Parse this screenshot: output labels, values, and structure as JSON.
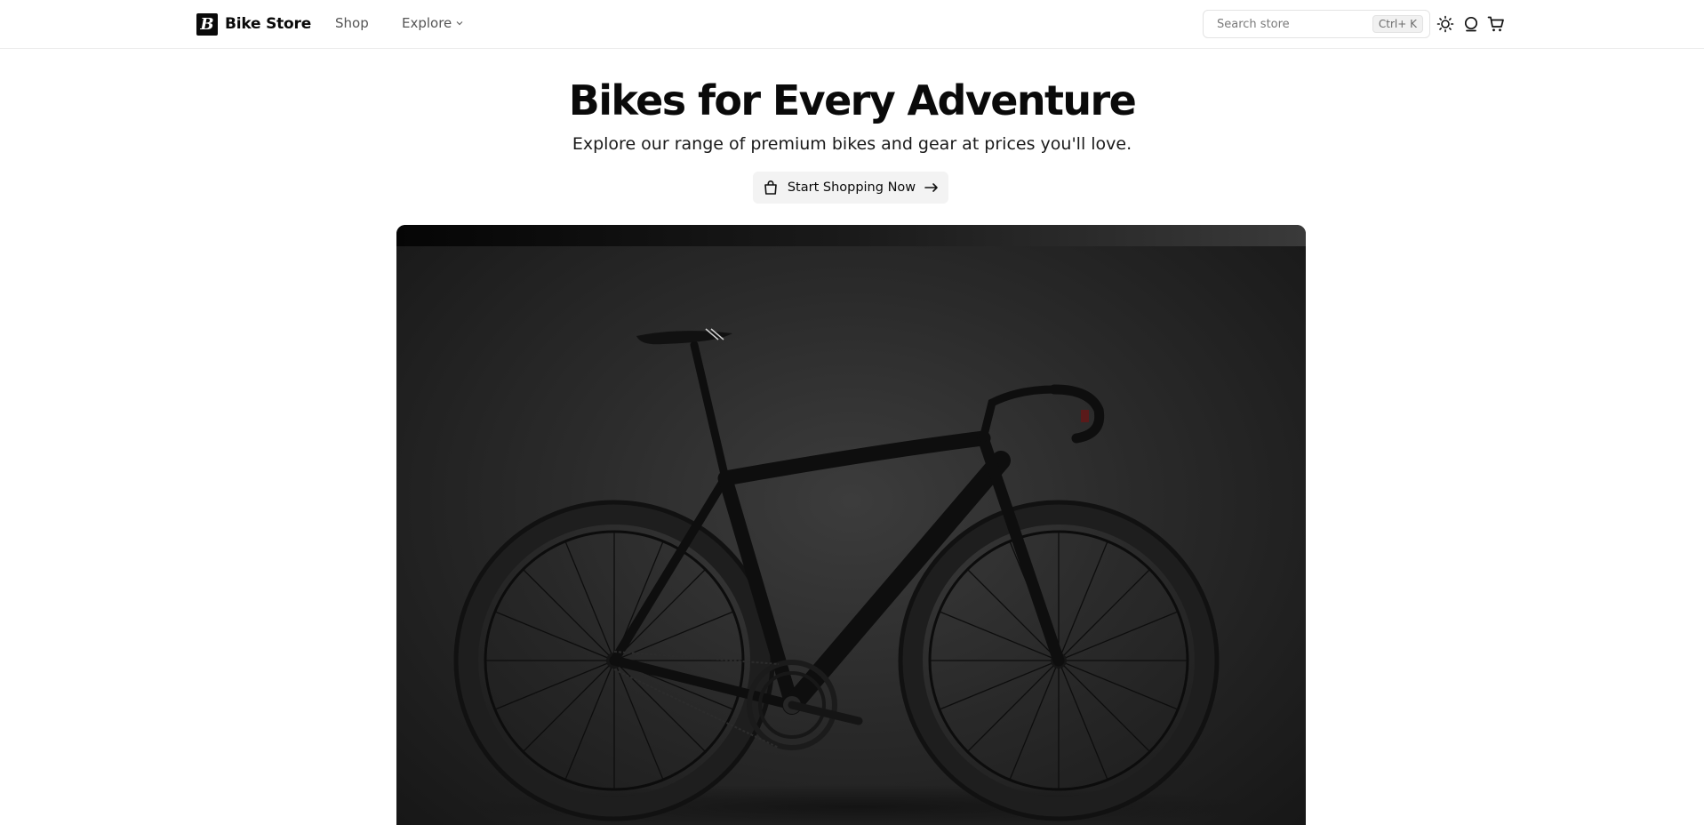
{
  "header": {
    "brand_letter": "B",
    "brand_name": "Bike Store",
    "nav": {
      "shop": "Shop",
      "explore": "Explore"
    },
    "search": {
      "placeholder": "Search store",
      "shortcut": "Ctrl+ K"
    },
    "icons": [
      "sun-icon",
      "user-icon",
      "cart-icon"
    ]
  },
  "hero": {
    "title": "Bikes for Every Adventure",
    "subtitle": "Explore our range of premium bikes and gear at prices you'll love.",
    "cta_label": "Start Shopping Now",
    "image_subject": "black road bike"
  },
  "colors": {
    "text": "#0a0a0a",
    "muted": "#555555",
    "cta_bg": "#f3f3f3",
    "hero_bg": "#2a2a2a"
  }
}
